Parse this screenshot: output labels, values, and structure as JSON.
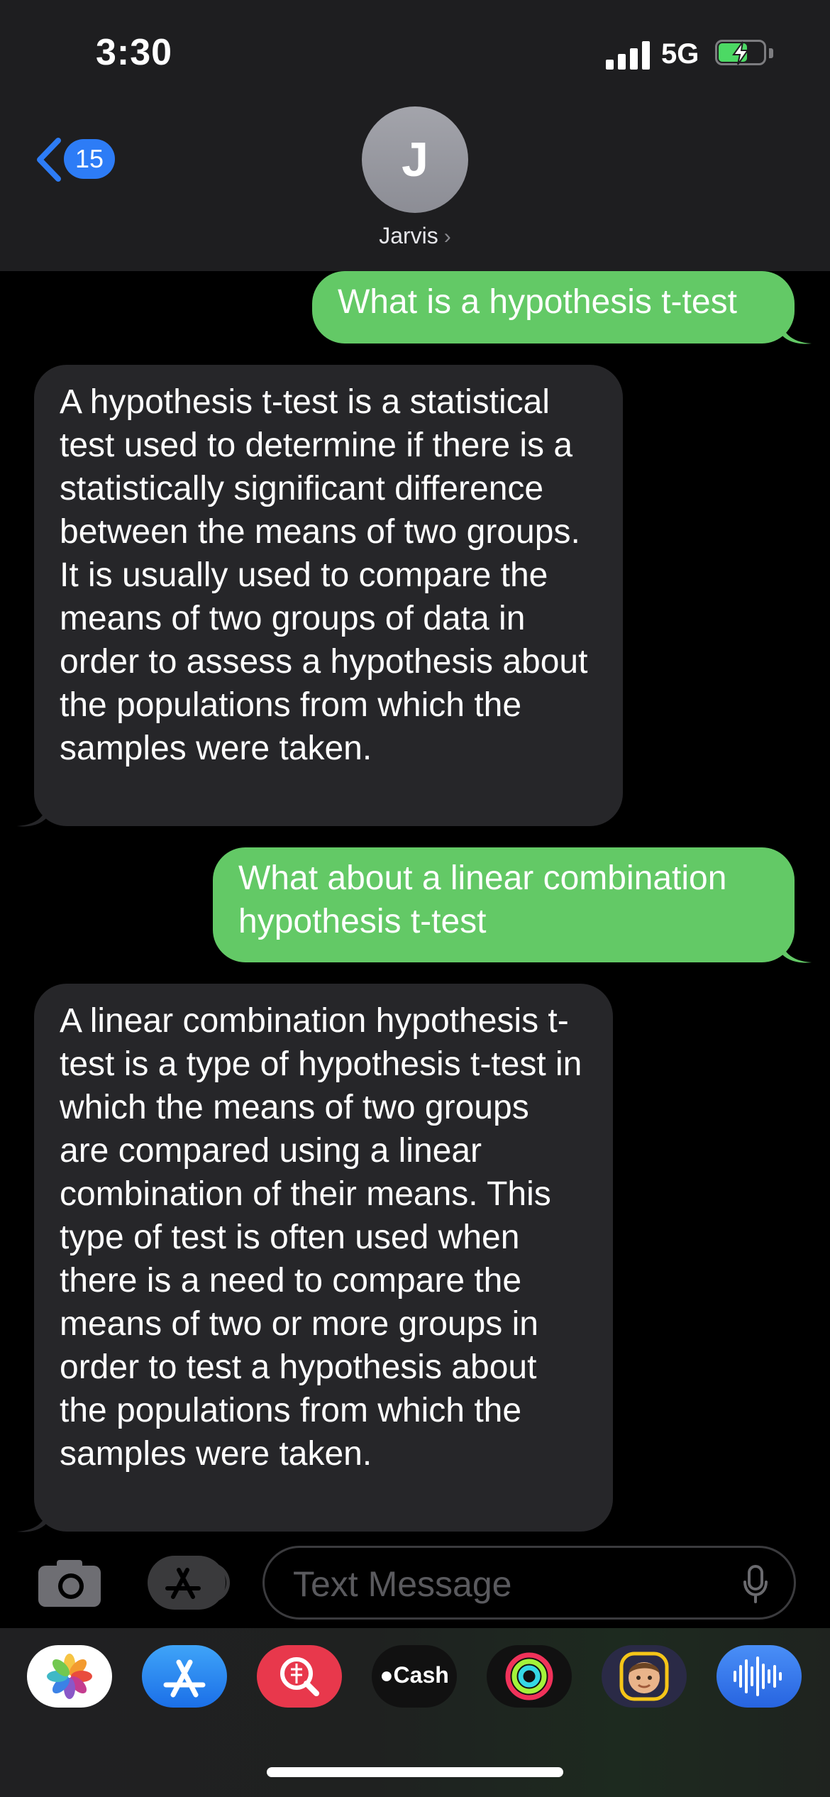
{
  "status_bar": {
    "time": "3:30",
    "network": "5G"
  },
  "header": {
    "back_badge": "15",
    "avatar_initial": "J",
    "contact_name": "Jarvis"
  },
  "messages": [
    {
      "direction": "outgoing",
      "text": "What is a hypothesis t-test"
    },
    {
      "direction": "incoming",
      "text": "A hypothesis t-test is a statistical test used to determine if there is a statistically significant difference between the means of two groups. It is usually used to compare the means of two groups of data in order to assess a hypothesis about the populations from which the samples were taken."
    },
    {
      "direction": "outgoing",
      "text": "What about a linear combination hypothesis t-test"
    },
    {
      "direction": "incoming",
      "text": "A linear combination hypothesis t-test is a type of hypothesis t-test in which the means of two groups are compared using a linear combination of their means. This type of test is often used when there is a need to compare the means of two or more groups in order to test a hypothesis about the populations from which the samples were taken."
    }
  ],
  "composer": {
    "placeholder": "Text Message"
  },
  "dock": {
    "apps": [
      {
        "icon": "photos-icon"
      },
      {
        "icon": "app-store-icon"
      },
      {
        "icon": "search-images-icon"
      },
      {
        "icon": "apple-cash-icon",
        "label": "Cash"
      },
      {
        "icon": "activity-icon"
      },
      {
        "icon": "memoji-icon"
      },
      {
        "icon": "audio-message-icon"
      }
    ]
  },
  "colors": {
    "outgoing_bubble": "#63c966",
    "incoming_bubble": "#262629",
    "accent": "#2d7cf6"
  }
}
